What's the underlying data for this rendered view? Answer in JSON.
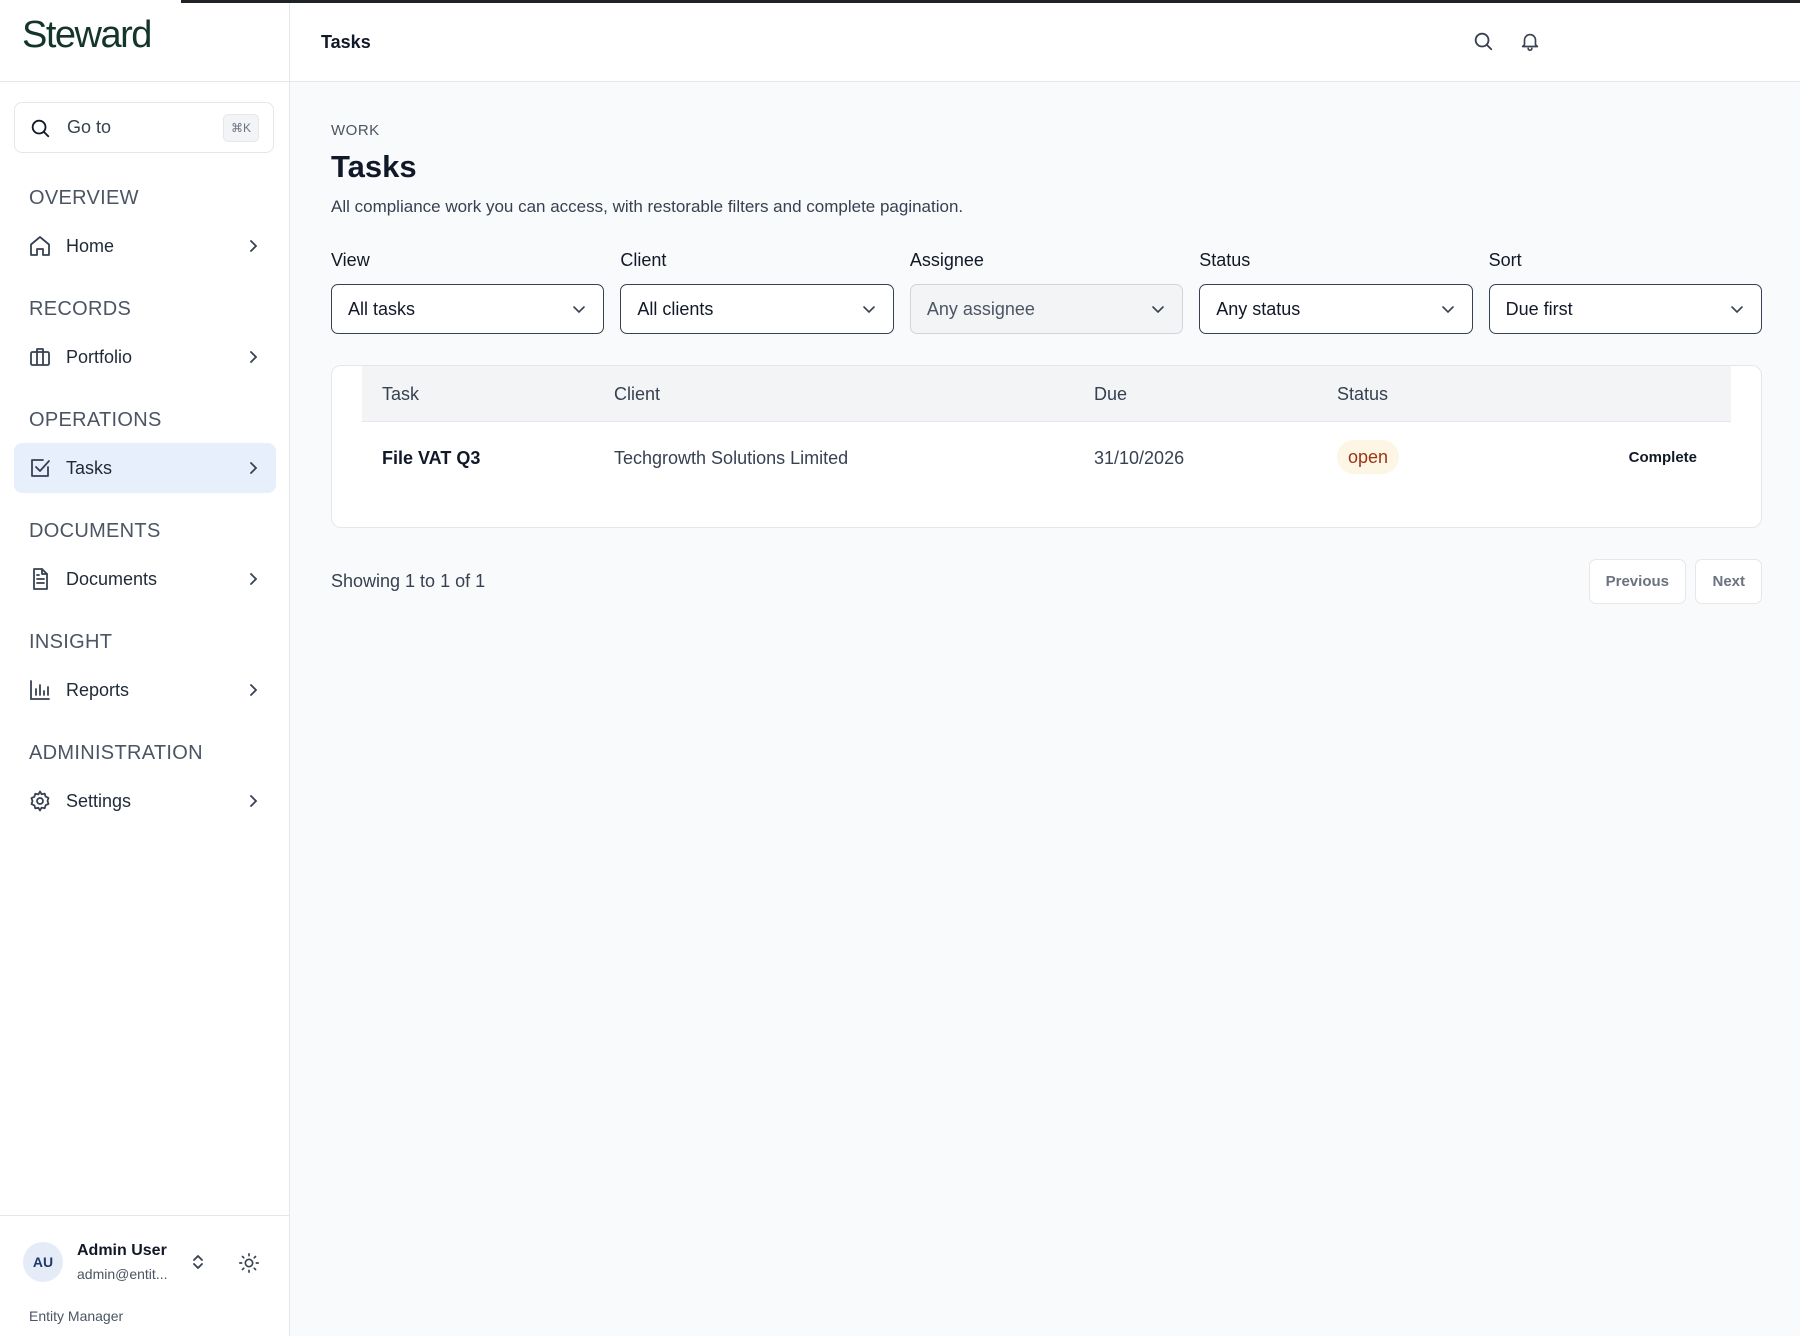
{
  "brand": {
    "logo_text": "Steward"
  },
  "search": {
    "label": "Go to",
    "shortcut": "⌘K"
  },
  "sidebar": {
    "sections": [
      {
        "heading": "OVERVIEW",
        "item": {
          "label": "Home",
          "icon": "home-icon"
        }
      },
      {
        "heading": "RECORDS",
        "item": {
          "label": "Portfolio",
          "icon": "briefcase-icon"
        }
      },
      {
        "heading": "OPERATIONS",
        "item": {
          "label": "Tasks",
          "icon": "checkbox-icon",
          "active": true
        }
      },
      {
        "heading": "DOCUMENTS",
        "item": {
          "label": "Documents",
          "icon": "document-icon"
        }
      },
      {
        "heading": "INSIGHT",
        "item": {
          "label": "Reports",
          "icon": "bar-chart-icon"
        }
      },
      {
        "heading": "ADMINISTRATION",
        "item": {
          "label": "Settings",
          "icon": "gear-icon"
        }
      }
    ]
  },
  "user": {
    "initials": "AU",
    "name": "Admin User",
    "email": "admin@entit...",
    "role": "Entity Manager"
  },
  "topbar": {
    "title": "Tasks"
  },
  "page": {
    "eyebrow": "WORK",
    "title": "Tasks",
    "description": "All compliance work you can access, with restorable filters and complete pagination."
  },
  "filters": [
    {
      "label": "View",
      "value": "All tasks",
      "disabled": false
    },
    {
      "label": "Client",
      "value": "All clients",
      "disabled": false
    },
    {
      "label": "Assignee",
      "value": "Any assignee",
      "disabled": true
    },
    {
      "label": "Status",
      "value": "Any status",
      "disabled": false
    },
    {
      "label": "Sort",
      "value": "Due first",
      "disabled": false
    }
  ],
  "table": {
    "columns": [
      "Task",
      "Client",
      "Due",
      "Status"
    ],
    "rows": [
      {
        "task": "File VAT Q3",
        "client": "Techgrowth Solutions Limited",
        "due": "31/10/2026",
        "status": "open",
        "action": "Complete"
      }
    ]
  },
  "pagination": {
    "summary": "Showing 1 to 1 of 1",
    "previous": "Previous",
    "next": "Next"
  },
  "colors": {
    "active_nav_bg": "#e6effb",
    "status_open_bg": "#fef6e4",
    "status_open_text": "#9a3412",
    "brand": "#14352a"
  }
}
